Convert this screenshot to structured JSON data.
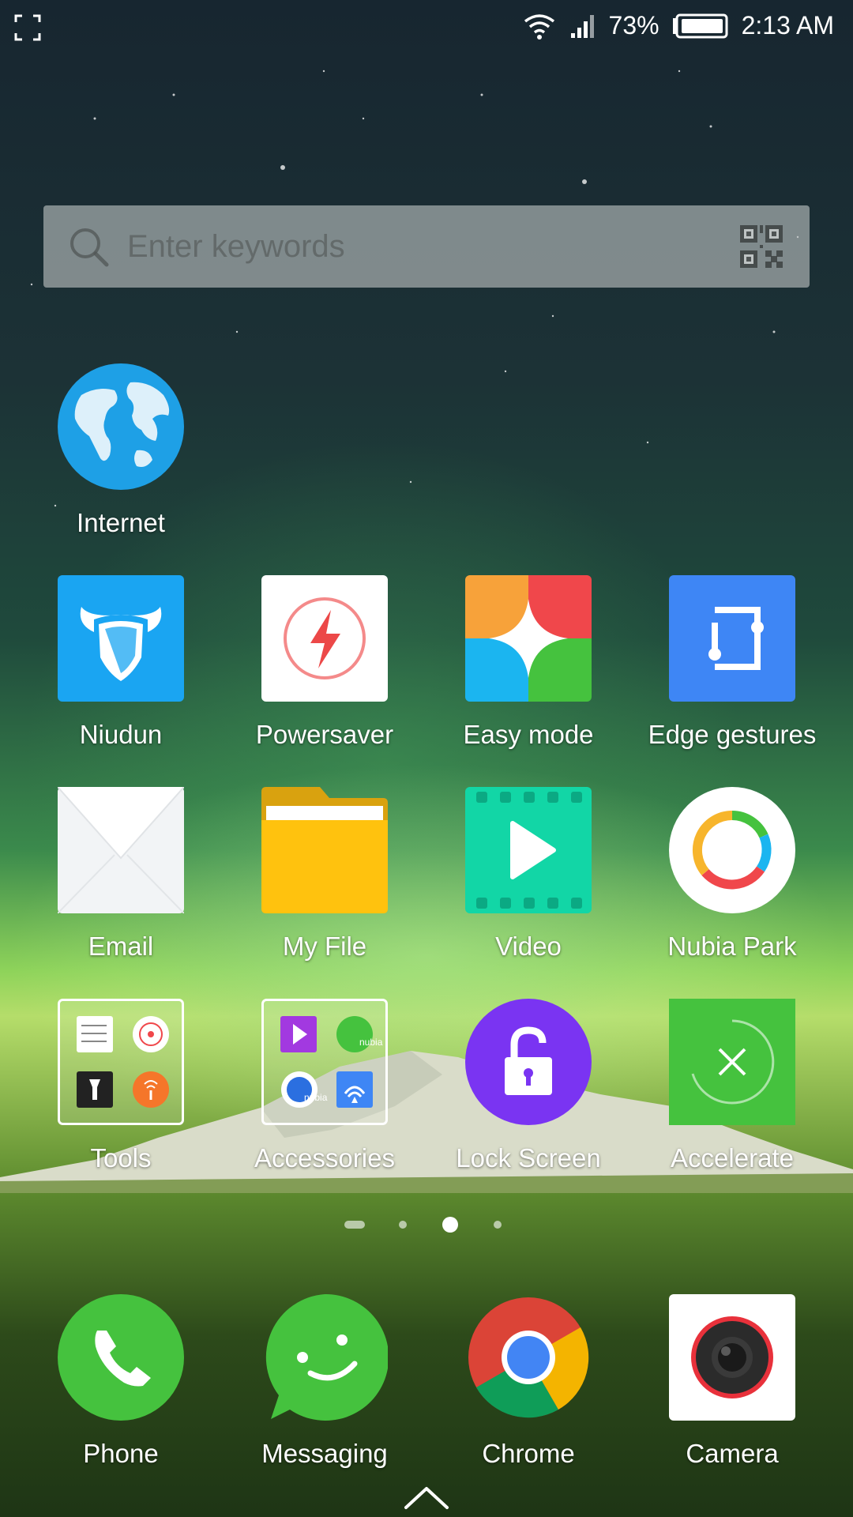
{
  "status_bar": {
    "battery_percent": "73%",
    "time": "2:13 AM",
    "icons": [
      "screenshot-icon",
      "wifi-icon",
      "signal-icon",
      "battery-icon"
    ]
  },
  "search": {
    "placeholder": "Enter keywords",
    "icons": [
      "search-icon",
      "qr-code-icon"
    ]
  },
  "apps": {
    "internet": "Internet",
    "niudun": "Niudun",
    "powersaver": "Powersaver",
    "easy_mode": "Easy mode",
    "edge_gestures": "Edge gestures",
    "email": "Email",
    "my_file": "My File",
    "video": "Video",
    "nubia_park": "Nubia Park",
    "tools": "Tools",
    "accessories": "Accessories",
    "lock_screen": "Lock Screen",
    "accelerate": "Accelerate"
  },
  "accessories_badge": "nubia",
  "dock": {
    "phone": "Phone",
    "messaging": "Messaging",
    "chrome": "Chrome",
    "camera": "Camera"
  },
  "page_indicator": {
    "pages": 4,
    "current": 3
  },
  "colors": {
    "accent_green": "#45C23E",
    "lock_purple": "#7A34F2",
    "niudun_blue": "#1AA5F2",
    "edge_blue": "#3E86F5"
  }
}
